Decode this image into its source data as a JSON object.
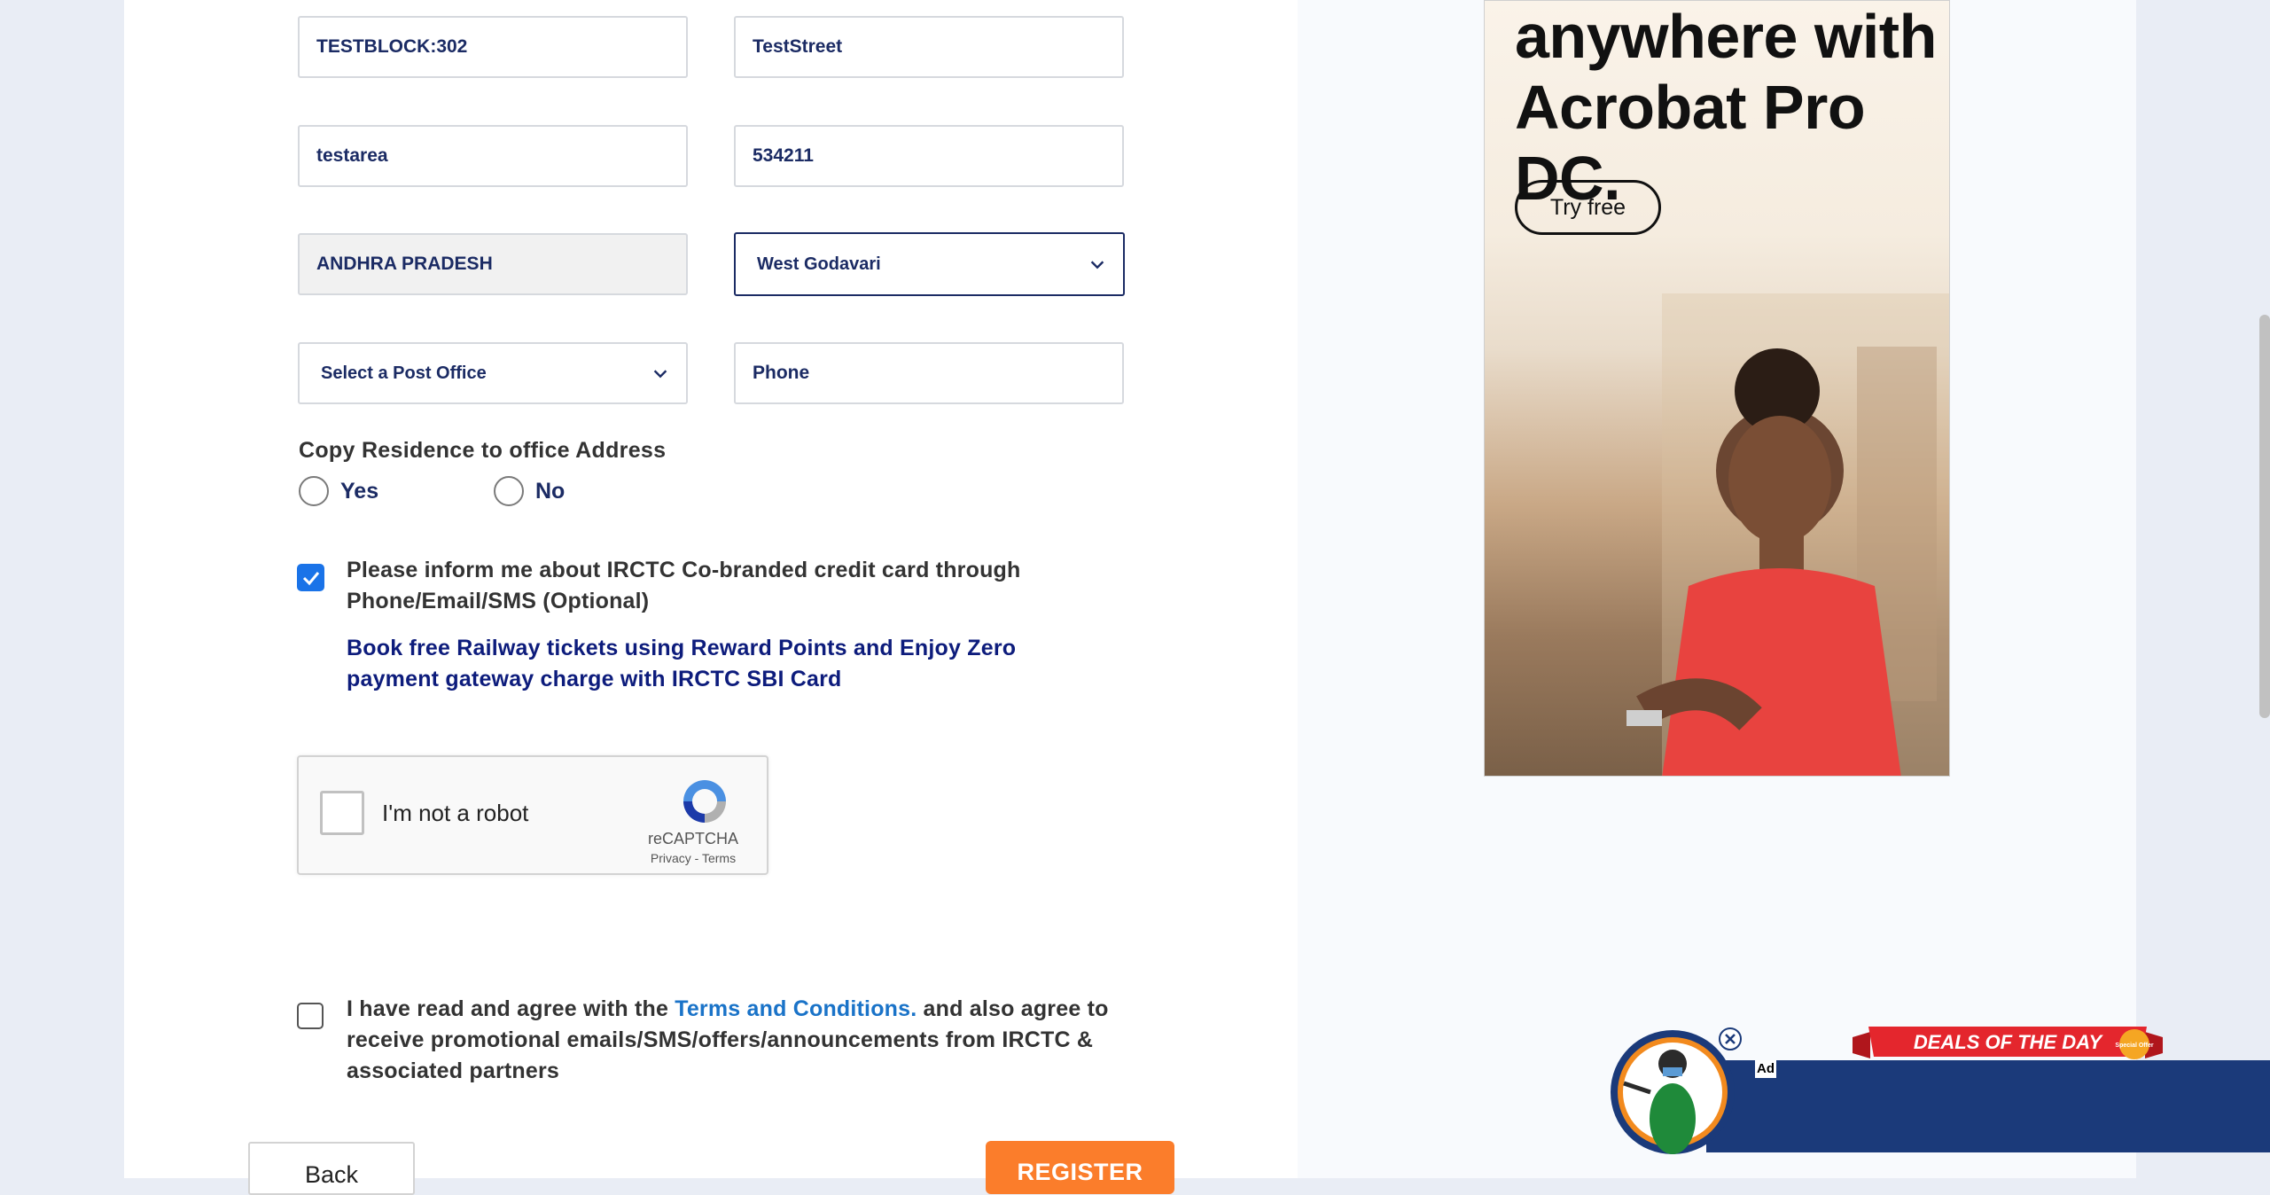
{
  "form": {
    "address_line1": "TESTBLOCK:302",
    "street": "TestStreet",
    "area": "testarea",
    "pincode": "534211",
    "state": "ANDHRA PRADESH",
    "district": "West Godavari",
    "post_office_placeholder": "Select a Post Office",
    "phone_placeholder": "Phone",
    "copy_residence_label": "Copy Residence to office Address",
    "radio_yes": "Yes",
    "radio_no": "No",
    "cobranded_text": "Please inform me about IRCTC Co-branded credit card through Phone/Email/SMS (Optional)",
    "promo_text": "Book free Railway tickets using Reward Points and Enjoy Zero payment gateway charge with IRCTC SBI Card",
    "terms_prefix": "I have read and agree with the ",
    "terms_link": "Terms and Conditions.",
    "terms_suffix": " and also agree to receive promotional emails/SMS/offers/announcements from IRCTC & associated partners",
    "back_button": "Back",
    "register_button": "REGISTER"
  },
  "recaptcha": {
    "label": "I'm not a robot",
    "brand": "reCAPTCHA",
    "links": "Privacy - Terms"
  },
  "ad": {
    "headline_line1": "anywhere with",
    "headline_line2": "Acrobat Pro DC.",
    "cta": "Try free"
  },
  "deals": {
    "ribbon_text": "DEALS OF THE DAY",
    "badge_text": "Special Offer",
    "ad_tag": "Ad"
  },
  "colors": {
    "navy": "#1b2b64",
    "checkbox_blue": "#1a73e8",
    "register_orange": "#fb7d2b",
    "link_blue": "#1a73c8",
    "deals_red": "#e4262d",
    "deals_bar": "#1b3a7a"
  },
  "icons": [
    "chevron-down-icon",
    "checkmark-icon",
    "recaptcha-logo-icon",
    "close-icon"
  ]
}
